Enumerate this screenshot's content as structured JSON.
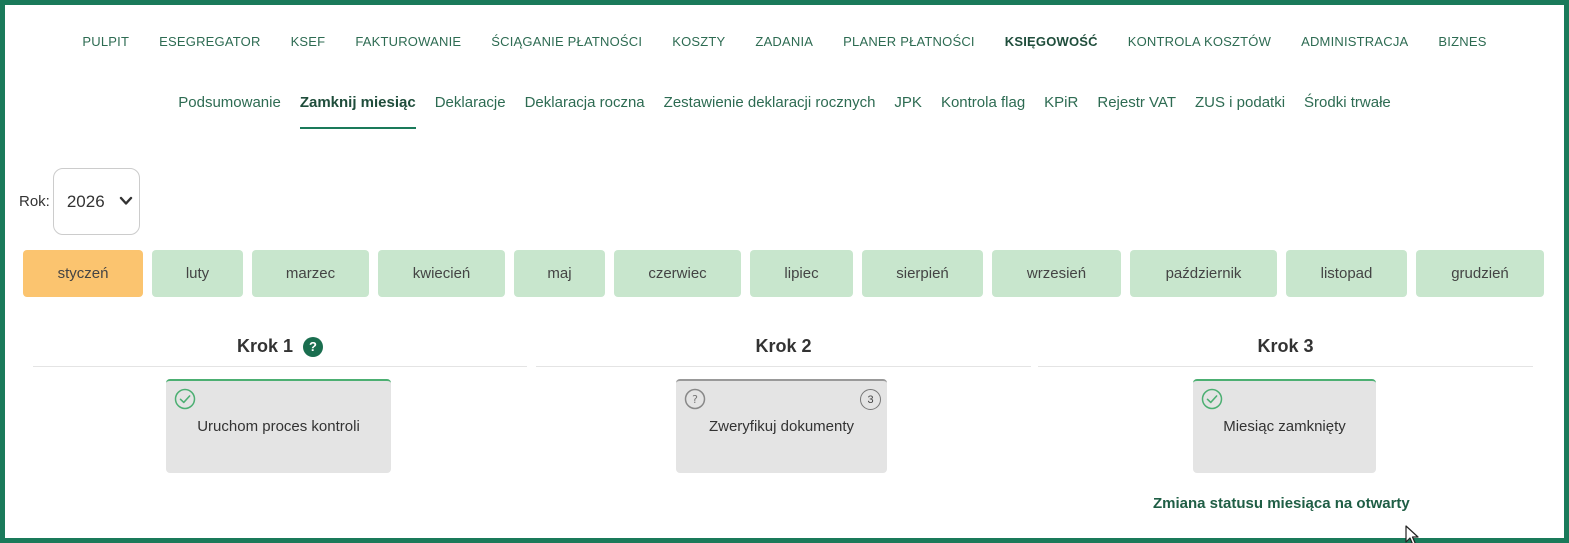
{
  "topnav": [
    {
      "label": "PULPIT"
    },
    {
      "label": "ESEGREGATOR"
    },
    {
      "label": "KSEF"
    },
    {
      "label": "FAKTUROWANIE"
    },
    {
      "label": "ŚCIĄGANIE PŁATNOŚCI"
    },
    {
      "label": "KOSZTY"
    },
    {
      "label": "ZADANIA"
    },
    {
      "label": "PLANER PŁATNOŚCI"
    },
    {
      "label": "KSIĘGOWOŚĆ",
      "active": true
    },
    {
      "label": "KONTROLA KOSZTÓW"
    },
    {
      "label": "ADMINISTRACJA"
    },
    {
      "label": "BIZNES"
    }
  ],
  "subnav": [
    {
      "label": "Podsumowanie"
    },
    {
      "label": "Zamknij miesiąc",
      "active": true
    },
    {
      "label": "Deklaracje"
    },
    {
      "label": "Deklaracja roczna"
    },
    {
      "label": "Zestawienie deklaracji rocznych"
    },
    {
      "label": "JPK"
    },
    {
      "label": "Kontrola flag"
    },
    {
      "label": "KPiR"
    },
    {
      "label": "Rejestr VAT"
    },
    {
      "label": "ZUS i podatki"
    },
    {
      "label": "Środki trwałe"
    }
  ],
  "year": {
    "label": "Rok:",
    "value": "2026"
  },
  "months": [
    {
      "label": "styczeń",
      "active": true
    },
    {
      "label": "luty"
    },
    {
      "label": "marzec"
    },
    {
      "label": "kwiecień"
    },
    {
      "label": "maj"
    },
    {
      "label": "czerwiec"
    },
    {
      "label": "lipiec"
    },
    {
      "label": "sierpień"
    },
    {
      "label": "wrzesień"
    },
    {
      "label": "październik"
    },
    {
      "label": "listopad"
    },
    {
      "label": "grudzień"
    }
  ],
  "steps": [
    {
      "title": "Krok 1",
      "help_icon": "?",
      "card_label": "Uruchom proces kontroli",
      "state": "done",
      "icon": "check-circle-icon"
    },
    {
      "title": "Krok 2",
      "card_label": "Zweryfikuj dokumenty",
      "state": "pending",
      "icon": "question-circle-icon",
      "count": "3"
    },
    {
      "title": "Krok 3",
      "card_label": "Miesiąc zamknięty",
      "state": "done",
      "icon": "check-circle-icon"
    }
  ],
  "reopen_link": "Zmiana statusu miesiąca na otwarty",
  "colors": {
    "frame": "#1a7a5a",
    "nav_text": "#2d6b52",
    "month_bg": "#c8e6cd",
    "month_active_bg": "#fbc46f",
    "card_bg": "#e4e4e4",
    "done_accent": "#4caf72"
  }
}
